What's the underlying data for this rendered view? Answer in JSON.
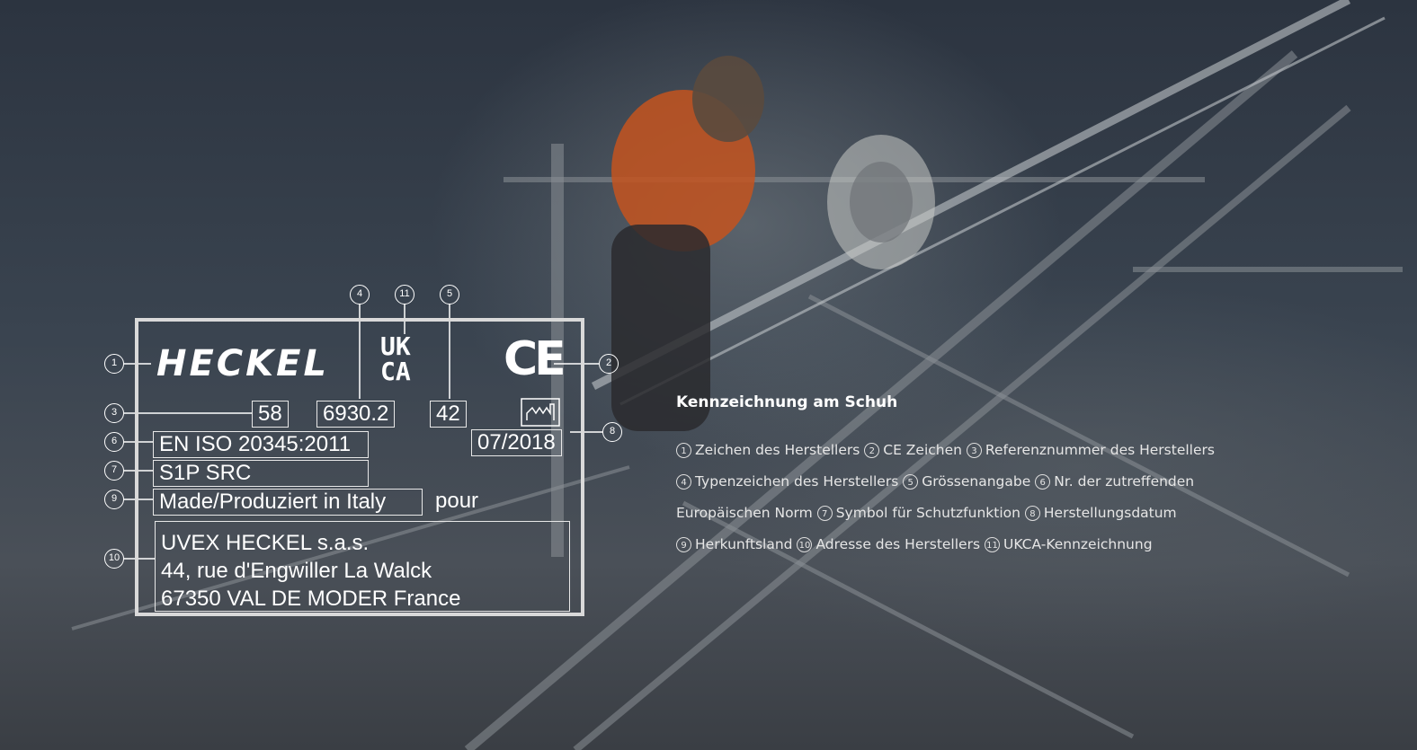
{
  "label": {
    "brand": "HECKEL",
    "ukca_line1": "UK",
    "ukca_line2": "CA",
    "ce_mark": "CE",
    "reference": "58",
    "type_code": "6930.2",
    "size": "42",
    "date": "07/2018",
    "norm": "EN ISO 20345:2011",
    "protection": "S1P SRC",
    "origin": "Made/Produziert in Italy",
    "pour": "pour",
    "address": [
      "UVEX HECKEL s.a.s.",
      "44, rue d'Engwiller La Walck",
      "67350 VAL DE MODER France"
    ]
  },
  "markers": {
    "m1": "1",
    "m2": "2",
    "m3": "3",
    "m4": "4",
    "m5": "5",
    "m6": "6",
    "m7": "7",
    "m8": "8",
    "m9": "9",
    "m10": "10",
    "m11": "11"
  },
  "legend": {
    "title": "Kennzeichnung am Schuh",
    "items": [
      {
        "n": "1",
        "text": "Zeichen des Herstellers"
      },
      {
        "n": "2",
        "text": "CE Zeichen"
      },
      {
        "n": "3",
        "text": "Referenznummer des Herstellers"
      },
      {
        "n": "4",
        "text": "Typenzeichen des Herstellers"
      },
      {
        "n": "5",
        "text": "Grössenangabe"
      },
      {
        "n": "6",
        "text": "Nr. der zutreffenden"
      },
      {
        "n": "6b",
        "text": "Europäischen Norm"
      },
      {
        "n": "7",
        "text": "Symbol für Schutzfunktion"
      },
      {
        "n": "8",
        "text": "Herstellungsdatum"
      },
      {
        "n": "9",
        "text": "Herkunftsland"
      },
      {
        "n": "10",
        "text": "Adresse des Herstellers"
      },
      {
        "n": "11",
        "text": "UKCA-Kennzeichnung"
      }
    ]
  },
  "icons": {
    "factory": "factory-date-icon"
  },
  "colors": {
    "background": "#3a4149",
    "frame": "#d9d9d9",
    "text": "#ffffff"
  }
}
